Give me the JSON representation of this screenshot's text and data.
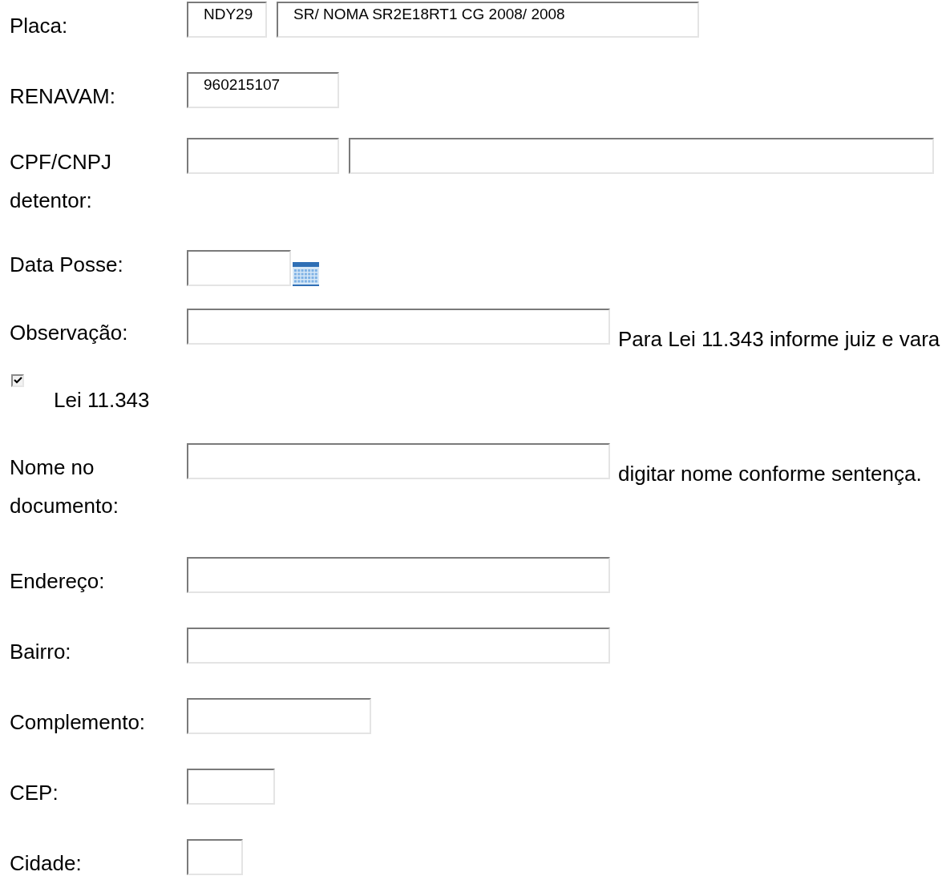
{
  "rows": [
    {
      "kind": "fields",
      "label": "Placa:",
      "inputs": [
        {
          "kind": "text",
          "value": "NDY29"
        },
        {
          "kind": "text",
          "value": "SR/ NOMA SR2E18RT1 CG 2008/ 2008"
        }
      ]
    },
    {
      "kind": "fields",
      "label": "RENAVAM:",
      "inputs": [
        {
          "kind": "text",
          "value": "960215107"
        }
      ]
    },
    {
      "kind": "fields",
      "label": "CPF/CNPJ detentor:",
      "inputs": [
        {
          "kind": "text"
        },
        {
          "kind": "text"
        }
      ]
    },
    {
      "kind": "fields",
      "label": "Data Posse:",
      "inputs": [
        {
          "kind": "date"
        }
      ]
    },
    {
      "kind": "fields",
      "label": "Observação:",
      "inputs": [
        {
          "kind": "text"
        }
      ],
      "note": "Para Lei 11.343 informe juiz e vara"
    },
    {
      "kind": "checkbox",
      "label": "Lei 11.343",
      "checked": true
    },
    {
      "kind": "fields",
      "label": "Nome no documento:",
      "inputs": [
        {
          "kind": "text"
        }
      ],
      "note": "digitar nome conforme sentença."
    },
    {
      "kind": "fields",
      "label": "Endereço:",
      "inputs": [
        {
          "kind": "text"
        }
      ]
    },
    {
      "kind": "fields",
      "label": "Bairro:",
      "inputs": [
        {
          "kind": "text"
        }
      ]
    },
    {
      "kind": "fields",
      "label": "Complemento:",
      "inputs": [
        {
          "kind": "text"
        }
      ]
    },
    {
      "kind": "fields",
      "label": "CEP:",
      "inputs": [
        {
          "kind": "text"
        }
      ]
    },
    {
      "kind": "fields",
      "label": "Cidade:",
      "inputs": [
        {
          "kind": "text"
        }
      ]
    }
  ]
}
